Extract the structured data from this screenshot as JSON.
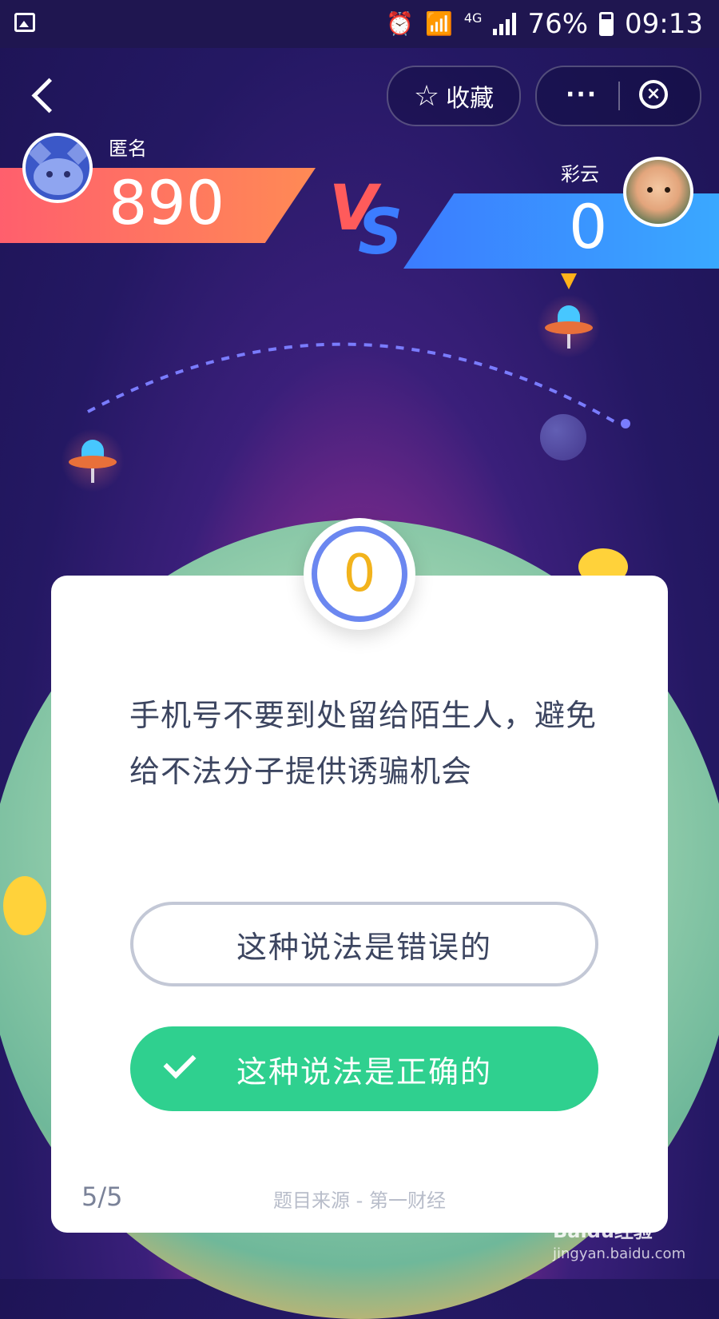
{
  "status_bar": {
    "signal_type": "4G",
    "battery": "76%",
    "time": "09:13",
    "icons": [
      "image-icon",
      "alarm-icon",
      "wifi-icon",
      "signal-icon",
      "battery-icon"
    ]
  },
  "header": {
    "favorite_label": "收藏",
    "icons": [
      "back-icon",
      "star-icon",
      "more-icon",
      "close-icon"
    ]
  },
  "players": {
    "left": {
      "name": "匿名",
      "score": "890"
    },
    "right": {
      "name": "彩云",
      "score": "0"
    },
    "vs_v": "V",
    "vs_s": "S"
  },
  "timer": {
    "value": "0"
  },
  "question": {
    "text": "手机号不要到处留给陌生人，避免给不法分子提供诱骗机会"
  },
  "options": [
    {
      "label": "这种说法是错误的",
      "state": "default"
    },
    {
      "label": "这种说法是正确的",
      "state": "selected"
    }
  ],
  "footer": {
    "progress": "5/5",
    "source": "题目来源 - 第一财经"
  },
  "watermark": {
    "brand": "Baidu经验",
    "url": "jingyan.baidu.com"
  },
  "colors": {
    "left_bar": "#ff6b5f",
    "right_bar": "#3b8cff",
    "correct": "#2fd08f",
    "timer": "#f2b31c"
  }
}
